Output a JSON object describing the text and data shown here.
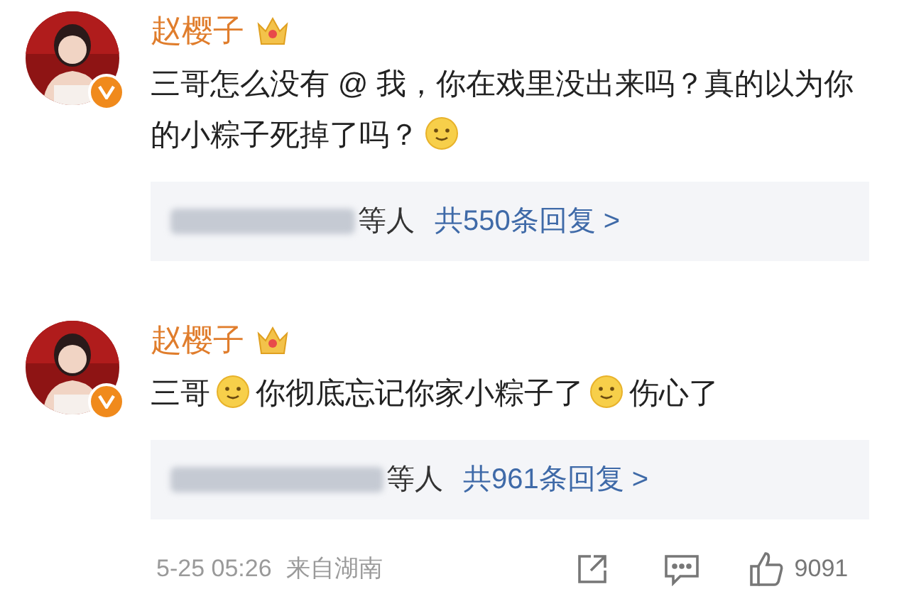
{
  "comments": [
    {
      "author": "赵樱子",
      "verified": true,
      "content": [
        {
          "kind": "text",
          "text": "三哥怎么没有 @ 我，你在戏里没出来吗？真的以为你的小粽子死掉了吗？"
        },
        {
          "kind": "emoji"
        }
      ],
      "replies": {
        "suffix": "等人",
        "count_text": "共550条回复 >"
      }
    },
    {
      "author": "赵樱子",
      "verified": true,
      "content": [
        {
          "kind": "text",
          "text": "三哥"
        },
        {
          "kind": "emoji"
        },
        {
          "kind": "text",
          "text": "你彻底忘记你家小粽子了"
        },
        {
          "kind": "emoji"
        },
        {
          "kind": "text",
          "text": "伤心了"
        }
      ],
      "replies": {
        "suffix": "等人",
        "count_text": "共961条回复 >"
      }
    }
  ],
  "footer": {
    "time": "5-25 05:26",
    "source": "来自湖南",
    "likes": "9091"
  }
}
